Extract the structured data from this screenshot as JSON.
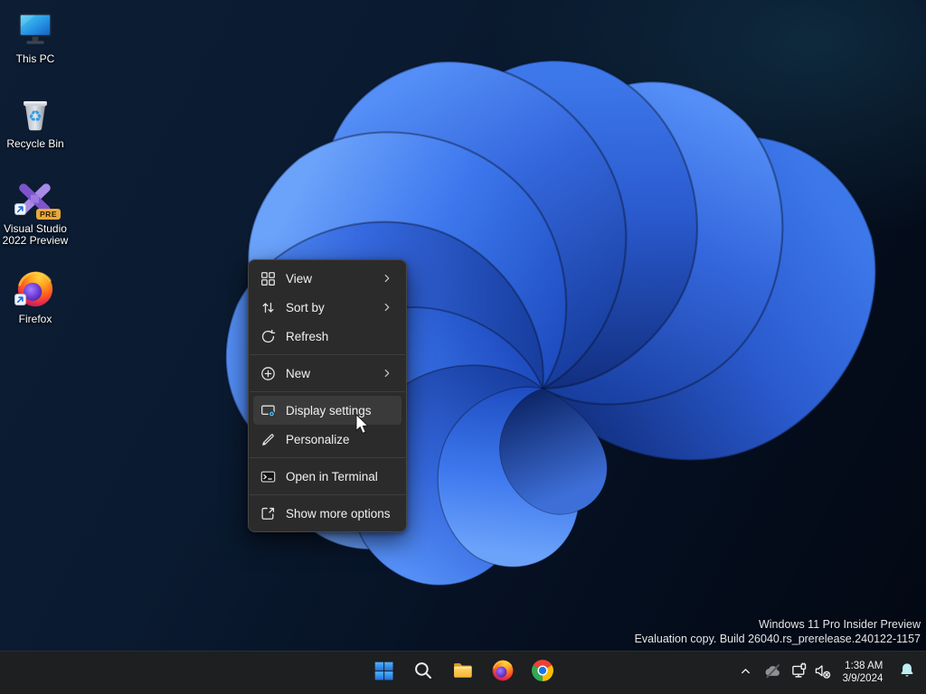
{
  "desktop": {
    "icons": [
      {
        "name": "this-pc",
        "icon": "monitor-icon",
        "label_lines": [
          "This PC"
        ]
      },
      {
        "name": "recycle-bin",
        "icon": "recycle-bin-icon",
        "label_lines": [
          "Recycle Bin"
        ]
      },
      {
        "name": "visual-studio",
        "icon": "visual-studio-icon",
        "label_lines": [
          "Visual Studio",
          "2022 Preview"
        ],
        "badge": "PRE",
        "has_shortcut_arrow": true
      },
      {
        "name": "firefox",
        "icon": "firefox-icon",
        "label_lines": [
          "Firefox"
        ],
        "has_shortcut_arrow": true
      }
    ]
  },
  "context_menu": {
    "items": [
      {
        "label": "View",
        "icon": "view-grid-icon",
        "has_submenu": true
      },
      {
        "label": "Sort by",
        "icon": "sort-arrows-icon",
        "has_submenu": true
      },
      {
        "label": "Refresh",
        "icon": "refresh-icon",
        "has_submenu": false
      },
      {
        "label": "New",
        "icon": "new-plus-circle-icon",
        "has_submenu": true
      },
      {
        "label": "Display settings",
        "icon": "display-settings-icon",
        "has_submenu": false,
        "state": "hover"
      },
      {
        "label": "Personalize",
        "icon": "personalize-brush-icon",
        "has_submenu": false
      },
      {
        "label": "Open in Terminal",
        "icon": "terminal-icon",
        "has_submenu": false
      },
      {
        "label": "Show more options",
        "icon": "expand-icon",
        "has_submenu": false
      }
    ]
  },
  "watermark": {
    "line1": "Windows 11 Pro Insider Preview",
    "line2": "Evaluation copy. Build 26040.rs_prerelease.240122-1157"
  },
  "taskbar": {
    "items": [
      {
        "name": "start",
        "icon": "windows-logo-icon"
      },
      {
        "name": "search",
        "icon": "search-icon"
      },
      {
        "name": "file-explorer",
        "icon": "folder-icon"
      },
      {
        "name": "firefox",
        "icon": "firefox-icon"
      },
      {
        "name": "chrome",
        "icon": "chrome-icon"
      }
    ],
    "tray": {
      "time": "1:38 AM",
      "date": "3/9/2024",
      "icons": [
        "hidden-icons-chevron",
        "onedrive-offline-icon",
        "network-ethernet-icon",
        "volume-muted-icon",
        "notification-bell-icon"
      ]
    }
  },
  "colors": {
    "taskbar_bg": "#1d1f20",
    "menu_bg": "#2b2b2b",
    "menu_hover": "#3a3a3a",
    "bell": "#bfeef4",
    "accent_blue": "#2f7ce0",
    "gear_blue": "#45b8f5"
  }
}
